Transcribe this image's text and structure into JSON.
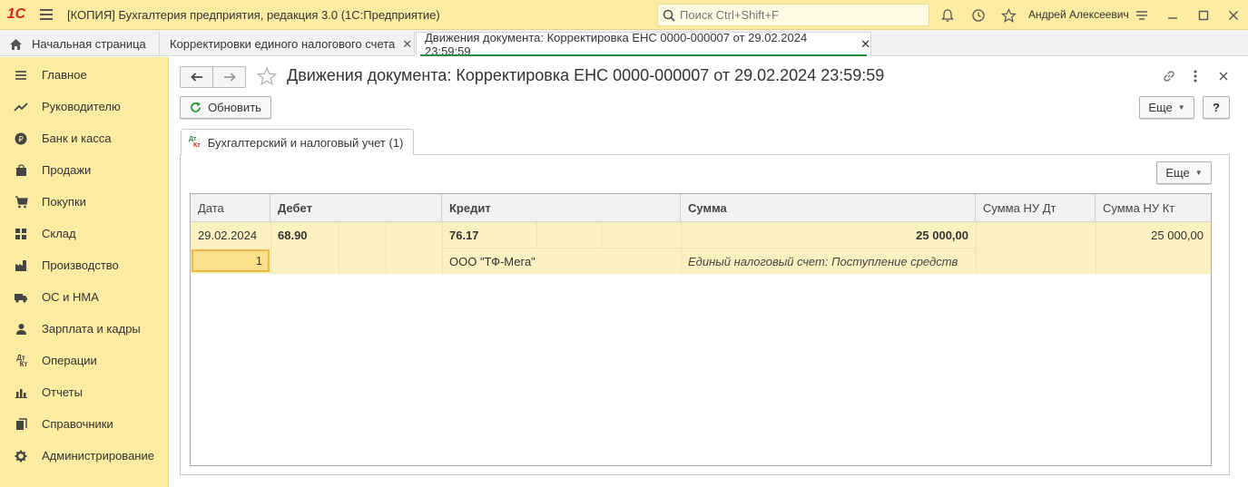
{
  "titlebar": {
    "logo": "1С",
    "title": "[КОПИЯ] Бухгалтерия предприятия, редакция 3.0  (1С:Предприятие)",
    "search_placeholder": "Поиск Ctrl+Shift+F",
    "user": "Андрей Алексеевич"
  },
  "tabs": [
    {
      "label": "Начальная страница"
    },
    {
      "label": "Корректировки единого налогового счета"
    },
    {
      "label": "Движения документа: Корректировка ЕНС 0000-000007 от 29.02.2024 23:59:59"
    }
  ],
  "sidebar": {
    "items": [
      {
        "label": "Главное",
        "icon": "menu-lines-icon"
      },
      {
        "label": "Руководителю",
        "icon": "trend-icon"
      },
      {
        "label": "Банк и касса",
        "icon": "coin-icon"
      },
      {
        "label": "Продажи",
        "icon": "bag-icon"
      },
      {
        "label": "Покупки",
        "icon": "cart-icon"
      },
      {
        "label": "Склад",
        "icon": "warehouse-icon"
      },
      {
        "label": "Производство",
        "icon": "factory-icon"
      },
      {
        "label": "ОС и НМА",
        "icon": "truck-icon"
      },
      {
        "label": "Зарплата и кадры",
        "icon": "person-icon"
      },
      {
        "label": "Операции",
        "icon": "dt-kt-icon"
      },
      {
        "label": "Отчеты",
        "icon": "bar-chart-icon"
      },
      {
        "label": "Справочники",
        "icon": "books-icon"
      },
      {
        "label": "Администрирование",
        "icon": "gear-icon"
      }
    ]
  },
  "document": {
    "title": "Движения документа: Корректировка ЕНС 0000-000007 от 29.02.2024 23:59:59",
    "refresh_label": "Обновить",
    "more_label": "Еще",
    "help_label": "?",
    "subtab_label": "Бухгалтерский и налоговый учет (1)",
    "dtkt_top": "Дт",
    "dtkt_bottom": "Кт",
    "grid_more_label": "Еще"
  },
  "table": {
    "headers": {
      "date": "Дата",
      "debit": "Дебет",
      "credit": "Кредит",
      "sum": "Сумма",
      "sum_nu_dt": "Сумма НУ Дт",
      "sum_nu_kt": "Сумма НУ Кт"
    },
    "rows": [
      {
        "date": "29.02.2024",
        "line_number": "1",
        "debit_account": "68.90",
        "credit_account": "76.17",
        "credit_subconto": "ООО \"ТФ-Мега\"",
        "sum": "25 000,00",
        "content": "Единый налоговый счет: Поступление средств",
        "sum_nu_dt": "",
        "sum_nu_kt": "25 000,00"
      }
    ]
  },
  "colors": {
    "accent_yellow": "#fbeca2",
    "row_highlight": "#fbf1c0",
    "active_tab_underline": "#2b8a4a",
    "refresh_green": "#2b9a3e",
    "logo_red": "#d8261c"
  }
}
